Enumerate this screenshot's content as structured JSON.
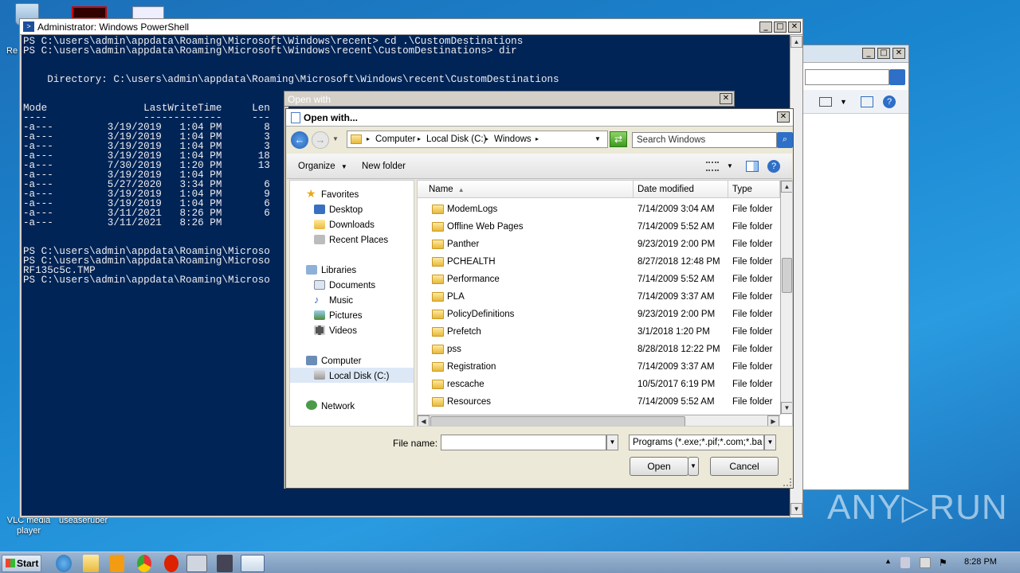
{
  "desktop": {
    "icons": [
      {
        "label": "Re",
        "color": "#7aa4d6"
      },
      {
        "label": "VLC media player",
        "color": "#f18a1a"
      },
      {
        "label": "useaseruber",
        "color": "#5585c0"
      }
    ],
    "watermark": "ANY▷RUN"
  },
  "powershell": {
    "title": "Administrator: Windows PowerShell",
    "lines": [
      "PS C:\\users\\admin\\appdata\\Roaming\\Microsoft\\Windows\\recent> cd .\\CustomDestinations",
      "PS C:\\users\\admin\\appdata\\Roaming\\Microsoft\\Windows\\recent\\CustomDestinations> dir",
      "",
      "",
      "    Directory: C:\\users\\admin\\appdata\\Roaming\\Microsoft\\Windows\\recent\\CustomDestinations",
      "",
      "",
      "Mode                LastWriteTime     Len",
      "----                -------------     ---",
      "-a---         3/19/2019   1:04 PM       8",
      "-a---         3/19/2019   1:04 PM       3",
      "-a---         3/19/2019   1:04 PM       3",
      "-a---         3/19/2019   1:04 PM      18",
      "-a---         7/30/2019   1:20 PM      13",
      "-a---         3/19/2019   1:04 PM",
      "-a---         5/27/2020   3:34 PM       6",
      "-a---         3/19/2019   1:04 PM       9",
      "-a---         3/19/2019   1:04 PM       6",
      "-a---         3/11/2021   8:26 PM       6",
      "-a---         3/11/2021   8:26 PM",
      "",
      "",
      "PS C:\\users\\admin\\appdata\\Roaming\\Microso",
      "PS C:\\users\\admin\\appdata\\Roaming\\Microso",
      "RF135c5c.TMP",
      "PS C:\\users\\admin\\appdata\\Roaming\\Microso"
    ]
  },
  "outer_dialog": {
    "title": "Open with"
  },
  "dialog": {
    "title": "Open with...",
    "breadcrumb": [
      "Computer",
      "Local Disk (C:)",
      "Windows"
    ],
    "search_placeholder": "Search Windows",
    "organize_label": "Organize",
    "new_folder_label": "New folder",
    "nav": {
      "favorites_label": "Favorites",
      "favorites": [
        "Desktop",
        "Downloads",
        "Recent Places"
      ],
      "libraries_label": "Libraries",
      "libraries": [
        "Documents",
        "Music",
        "Pictures",
        "Videos"
      ],
      "computer_label": "Computer",
      "computer_items": [
        "Local Disk (C:)"
      ],
      "network_label": "Network"
    },
    "columns": {
      "name": "Name",
      "date": "Date modified",
      "type": "Type"
    },
    "rows": [
      {
        "name": "ModemLogs",
        "date": "7/14/2009 3:04 AM",
        "type": "File folder"
      },
      {
        "name": "Offline Web Pages",
        "date": "7/14/2009 5:52 AM",
        "type": "File folder"
      },
      {
        "name": "Panther",
        "date": "9/23/2019 2:00 PM",
        "type": "File folder"
      },
      {
        "name": "PCHEALTH",
        "date": "8/27/2018 12:48 PM",
        "type": "File folder"
      },
      {
        "name": "Performance",
        "date": "7/14/2009 5:52 AM",
        "type": "File folder"
      },
      {
        "name": "PLA",
        "date": "7/14/2009 3:37 AM",
        "type": "File folder"
      },
      {
        "name": "PolicyDefinitions",
        "date": "9/23/2019 2:00 PM",
        "type": "File folder"
      },
      {
        "name": "Prefetch",
        "date": "3/1/2018 1:20 PM",
        "type": "File folder"
      },
      {
        "name": "pss",
        "date": "8/28/2018 12:22 PM",
        "type": "File folder"
      },
      {
        "name": "Registration",
        "date": "7/14/2009 3:37 AM",
        "type": "File folder"
      },
      {
        "name": "rescache",
        "date": "10/5/2017 6:19 PM",
        "type": "File folder"
      },
      {
        "name": "Resources",
        "date": "7/14/2009 5:52 AM",
        "type": "File folder"
      }
    ],
    "file_name_label": "File name:",
    "file_name_value": "",
    "filter_value": "Programs (*.exe;*.pif;*.com;*.ba",
    "open_label": "Open",
    "cancel_label": "Cancel"
  },
  "taskbar": {
    "start_label": "Start",
    "clock": "8:28 PM"
  }
}
